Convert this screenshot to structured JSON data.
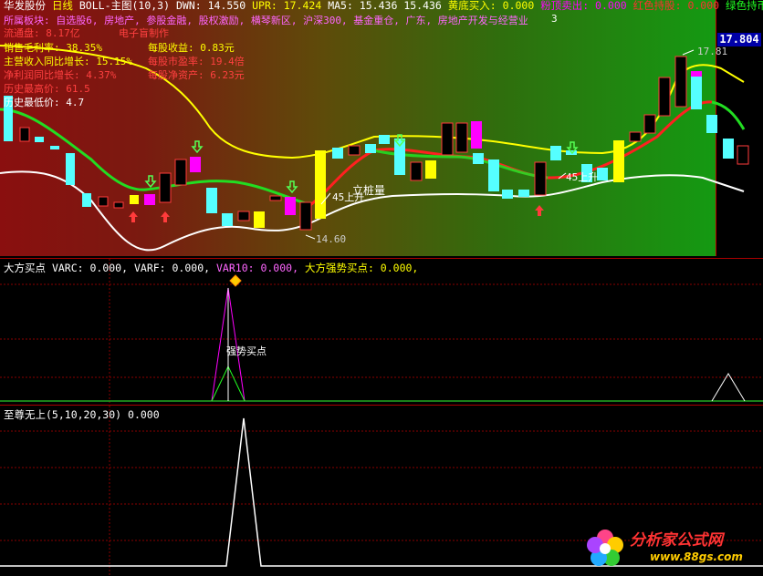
{
  "main_header": {
    "stock_name": "华发股份",
    "period": "日线",
    "indicator": "BOLL-主图(10,3)",
    "dwn": "DWN: 14.550",
    "upr": "UPR: 17.424",
    "ma5": "MA5: 15.436",
    "ma_val2": "15.436",
    "bottom_buy": "黄底买入: 0.000",
    "peak_sell": "粉顶卖出: 0.000",
    "red_hold": "红色持股: 0.000",
    "green_wait": "绿色持币: 0"
  },
  "info_lines": {
    "sector": "所属板块: 自选股6, 房地产, 参股金融, 股权激励, 横琴新区, 沪深300, 基金重仓, 广东, 房地产开发与经营业",
    "circulating_cap": "流通盘: 8.17亿",
    "author": "电子盲制作",
    "gross_margin": "销售毛利率: 38.35%",
    "eps": "每股收益: 0.83元",
    "revenue_growth": "主营收入同比增长: 15.15%",
    "pe": "每股市盈率: 19.4倍",
    "profit_growth": "净利润同比增长: 4.37%",
    "nav": "每股净资产: 6.23元",
    "hist_high": "历史最高价: 61.5",
    "hist_low": "历史最低价: 4.7"
  },
  "price_axis": {
    "current": "17.804"
  },
  "chart_annotations": {
    "low_price": "14.60",
    "high_price": "17.81",
    "up45_a": "45上升",
    "up45_b": "45上升",
    "pile_label": "立桩量",
    "peak_count": "3"
  },
  "panel2": {
    "title": "大方买点",
    "varc": "VARC: 0.000,",
    "varf": "VARF: 0.000,",
    "var10": "VAR10: 0.000,",
    "strong_buy": "大方强势买点: 0.000,",
    "signal_label": "强势买点"
  },
  "panel3": {
    "title": "至尊无上(5,10,20,30)",
    "value": "0.000"
  },
  "watermark": {
    "brand": "分析家公式网",
    "url": "www.88gs.com"
  },
  "colors": {
    "header_text": "#ffffff",
    "up_candle": "#ff3b3b",
    "down_candle": "#55ffff",
    "boll_upper": "#ffff00",
    "boll_mid_green": "#22dd22",
    "boll_mid_red": "#ff2020",
    "boll_lower": "#ffffff",
    "magenta": "#ff00ff",
    "grid": "#a00000"
  }
}
